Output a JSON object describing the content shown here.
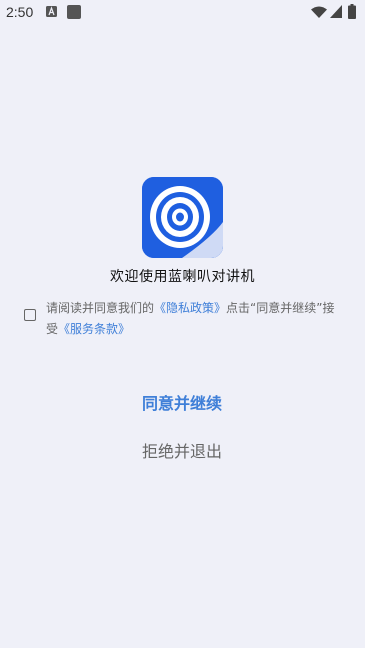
{
  "status_bar": {
    "time": "2:50",
    "icons": [
      "notification-a-icon",
      "notification-square-icon",
      "wifi-icon",
      "signal-icon",
      "battery-icon"
    ]
  },
  "app": {
    "logo_icon": "speaker-logo-icon",
    "welcome_title": "欢迎使用蓝喇叭对讲机"
  },
  "agreement": {
    "checked": false,
    "text_before": "请阅读并同意我们的",
    "privacy_link": "《隐私政策》",
    "text_middle": "点击“同意并继续”接受",
    "terms_link": "《服务条款》"
  },
  "buttons": {
    "agree": "同意并继续",
    "reject": "拒绝并退出"
  },
  "colors": {
    "background": "#eff0f8",
    "accent": "#3f7fd8",
    "logo_bg": "#1f5fe0"
  }
}
